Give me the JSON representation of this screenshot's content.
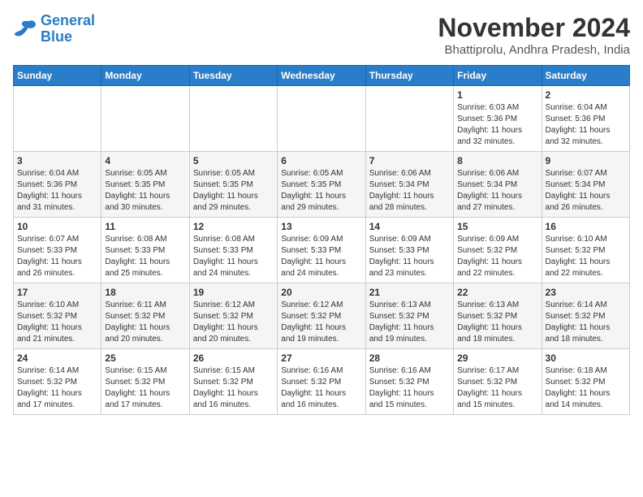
{
  "logo": {
    "line1": "General",
    "line2": "Blue"
  },
  "title": "November 2024",
  "subtitle": "Bhattiprolu, Andhra Pradesh, India",
  "days_of_week": [
    "Sunday",
    "Monday",
    "Tuesday",
    "Wednesday",
    "Thursday",
    "Friday",
    "Saturday"
  ],
  "weeks": [
    [
      {
        "day": "",
        "info": ""
      },
      {
        "day": "",
        "info": ""
      },
      {
        "day": "",
        "info": ""
      },
      {
        "day": "",
        "info": ""
      },
      {
        "day": "",
        "info": ""
      },
      {
        "day": "1",
        "info": "Sunrise: 6:03 AM\nSunset: 5:36 PM\nDaylight: 11 hours\nand 32 minutes."
      },
      {
        "day": "2",
        "info": "Sunrise: 6:04 AM\nSunset: 5:36 PM\nDaylight: 11 hours\nand 32 minutes."
      }
    ],
    [
      {
        "day": "3",
        "info": "Sunrise: 6:04 AM\nSunset: 5:36 PM\nDaylight: 11 hours\nand 31 minutes."
      },
      {
        "day": "4",
        "info": "Sunrise: 6:05 AM\nSunset: 5:35 PM\nDaylight: 11 hours\nand 30 minutes."
      },
      {
        "day": "5",
        "info": "Sunrise: 6:05 AM\nSunset: 5:35 PM\nDaylight: 11 hours\nand 29 minutes."
      },
      {
        "day": "6",
        "info": "Sunrise: 6:05 AM\nSunset: 5:35 PM\nDaylight: 11 hours\nand 29 minutes."
      },
      {
        "day": "7",
        "info": "Sunrise: 6:06 AM\nSunset: 5:34 PM\nDaylight: 11 hours\nand 28 minutes."
      },
      {
        "day": "8",
        "info": "Sunrise: 6:06 AM\nSunset: 5:34 PM\nDaylight: 11 hours\nand 27 minutes."
      },
      {
        "day": "9",
        "info": "Sunrise: 6:07 AM\nSunset: 5:34 PM\nDaylight: 11 hours\nand 26 minutes."
      }
    ],
    [
      {
        "day": "10",
        "info": "Sunrise: 6:07 AM\nSunset: 5:33 PM\nDaylight: 11 hours\nand 26 minutes."
      },
      {
        "day": "11",
        "info": "Sunrise: 6:08 AM\nSunset: 5:33 PM\nDaylight: 11 hours\nand 25 minutes."
      },
      {
        "day": "12",
        "info": "Sunrise: 6:08 AM\nSunset: 5:33 PM\nDaylight: 11 hours\nand 24 minutes."
      },
      {
        "day": "13",
        "info": "Sunrise: 6:09 AM\nSunset: 5:33 PM\nDaylight: 11 hours\nand 24 minutes."
      },
      {
        "day": "14",
        "info": "Sunrise: 6:09 AM\nSunset: 5:33 PM\nDaylight: 11 hours\nand 23 minutes."
      },
      {
        "day": "15",
        "info": "Sunrise: 6:09 AM\nSunset: 5:32 PM\nDaylight: 11 hours\nand 22 minutes."
      },
      {
        "day": "16",
        "info": "Sunrise: 6:10 AM\nSunset: 5:32 PM\nDaylight: 11 hours\nand 22 minutes."
      }
    ],
    [
      {
        "day": "17",
        "info": "Sunrise: 6:10 AM\nSunset: 5:32 PM\nDaylight: 11 hours\nand 21 minutes."
      },
      {
        "day": "18",
        "info": "Sunrise: 6:11 AM\nSunset: 5:32 PM\nDaylight: 11 hours\nand 20 minutes."
      },
      {
        "day": "19",
        "info": "Sunrise: 6:12 AM\nSunset: 5:32 PM\nDaylight: 11 hours\nand 20 minutes."
      },
      {
        "day": "20",
        "info": "Sunrise: 6:12 AM\nSunset: 5:32 PM\nDaylight: 11 hours\nand 19 minutes."
      },
      {
        "day": "21",
        "info": "Sunrise: 6:13 AM\nSunset: 5:32 PM\nDaylight: 11 hours\nand 19 minutes."
      },
      {
        "day": "22",
        "info": "Sunrise: 6:13 AM\nSunset: 5:32 PM\nDaylight: 11 hours\nand 18 minutes."
      },
      {
        "day": "23",
        "info": "Sunrise: 6:14 AM\nSunset: 5:32 PM\nDaylight: 11 hours\nand 18 minutes."
      }
    ],
    [
      {
        "day": "24",
        "info": "Sunrise: 6:14 AM\nSunset: 5:32 PM\nDaylight: 11 hours\nand 17 minutes."
      },
      {
        "day": "25",
        "info": "Sunrise: 6:15 AM\nSunset: 5:32 PM\nDaylight: 11 hours\nand 17 minutes."
      },
      {
        "day": "26",
        "info": "Sunrise: 6:15 AM\nSunset: 5:32 PM\nDaylight: 11 hours\nand 16 minutes."
      },
      {
        "day": "27",
        "info": "Sunrise: 6:16 AM\nSunset: 5:32 PM\nDaylight: 11 hours\nand 16 minutes."
      },
      {
        "day": "28",
        "info": "Sunrise: 6:16 AM\nSunset: 5:32 PM\nDaylight: 11 hours\nand 15 minutes."
      },
      {
        "day": "29",
        "info": "Sunrise: 6:17 AM\nSunset: 5:32 PM\nDaylight: 11 hours\nand 15 minutes."
      },
      {
        "day": "30",
        "info": "Sunrise: 6:18 AM\nSunset: 5:32 PM\nDaylight: 11 hours\nand 14 minutes."
      }
    ]
  ]
}
